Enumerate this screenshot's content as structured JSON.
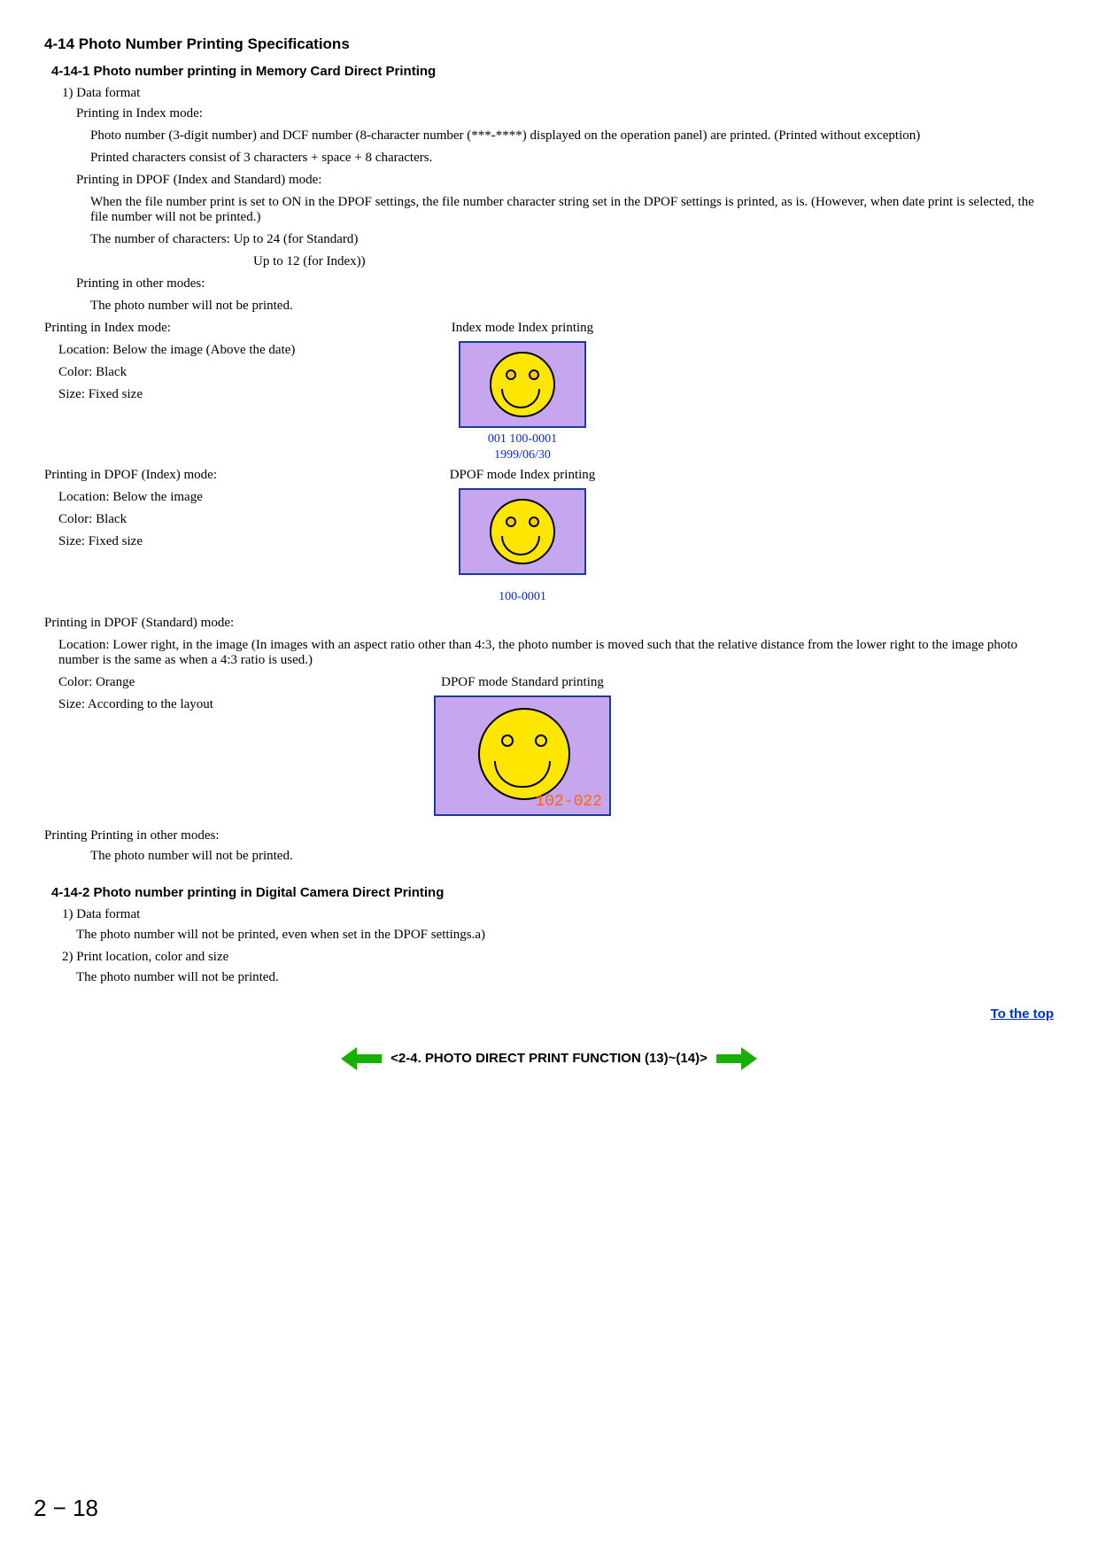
{
  "section_414": "4-14 Photo Number Printing Specifications",
  "section_4141": "4-14-1 Photo number printing in Memory Card Direct Printing",
  "s1_dataformat": "1) Data format",
  "idx_mode1": "Printing in Index mode:",
  "idx_mode1_l1": "Photo number (3-digit number) and DCF number (8-character number (***-****) displayed on the operation panel) are printed. (Printed without exception)",
  "idx_mode1_l2": "Printed characters consist of 3 characters + space + 8 characters.",
  "dpof_idx_std": "Printing in DPOF (Index and Standard) mode:",
  "dpof_idx_std_l1": "When the file number print is set to ON in the DPOF settings, the file number character string set in the DPOF settings is printed, as is. (However, when date print is selected, the file number will not be printed.)",
  "dpof_chars": "The number of characters: Up to 24 (for Standard)",
  "dpof_chars2": "Up to 12 (for Index))",
  "other_modes": "Printing in other modes:",
  "other_modes_l1": "The photo number will not be printed.",
  "idx_mode2": "Printing in Index mode:",
  "idx_loc": "Location: Below the image (Above the date)",
  "idx_color": "Color: Black",
  "idx_size": "Size: Fixed size",
  "fig1_title": "Index mode Index printing",
  "fig1_cap1": "001  100-0001",
  "fig1_cap2": "1999/06/30",
  "dpof_idx": "Printing in DPOF (Index) mode:",
  "dpof_idx_loc": "Location: Below the image",
  "dpof_idx_color": "Color: Black",
  "dpof_idx_size": "Size: Fixed size",
  "fig2_title": "DPOF mode Index printing",
  "fig2_cap": "100-0001",
  "dpof_std": "Printing in DPOF (Standard) mode:",
  "dpof_std_loc": "Location:  Lower right, in the image (In images with an aspect ratio other than 4:3, the photo number is moved such that the relative distance from the lower right  to the image photo number is the same as when a 4:3 ratio is used.)",
  "dpof_std_color": "Color: Orange",
  "dpof_std_size": "Size: According to the layout",
  "fig3_title": "DPOF mode Standard printing",
  "fig3_num": "102-022",
  "print_other": "Printing Printing in other modes:",
  "print_other_l1": "The photo number will not be printed.",
  "section_4142": "4-14-2 Photo number printing in Digital Camera Direct Printing",
  "s4142_df": "1) Data format",
  "s4142_df_l1": "The photo number will not be printed, even when set in the DPOF settings.a)",
  "s4142_pl": "2) Print location, color and size",
  "s4142_pl_l1": "The photo number will not be printed.",
  "to_top": "To the top",
  "nav_label": "<2-4. PHOTO DIRECT PRINT FUNCTION (13)~(14)>",
  "page_number": "2 − 18"
}
